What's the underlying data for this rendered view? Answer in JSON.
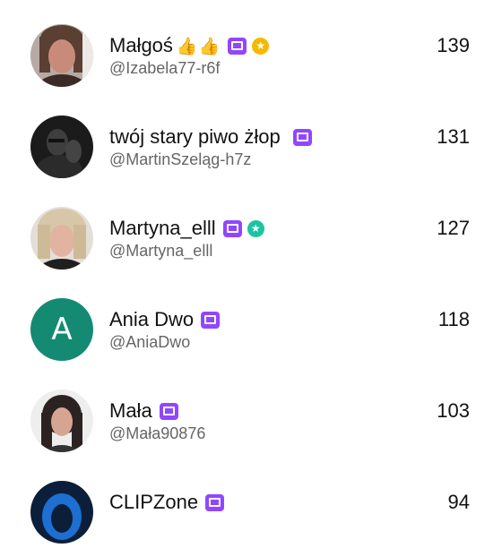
{
  "colors": {
    "sub_badge": "#9146ff",
    "gold_badge": "#f5b800",
    "teal_badge": "#1cc4a0",
    "letter_avatar": "#148a72"
  },
  "rows": [
    {
      "name": "Małgoś",
      "emoji": "👍👍",
      "handle": "@Izabela77-r6f",
      "score": "139",
      "badge_icon": "sub-badge-icon",
      "extra_badge": "gold-star-badge-icon"
    },
    {
      "name": "twój stary piwo żłop",
      "handle": "@MartinSzeląg-h7z",
      "score": "131",
      "badge_icon": "sub-badge-icon"
    },
    {
      "name": "Martyna_elll",
      "handle": "@Martyna_elll",
      "score": "127",
      "badge_icon": "sub-badge-icon",
      "extra_badge": "teal-star-badge-icon"
    },
    {
      "name": "Ania Dwo",
      "handle": "@AniaDwo",
      "score": "118",
      "badge_icon": "sub-badge-icon",
      "avatar_letter": "A"
    },
    {
      "name": "Mała",
      "handle": "@Mała90876",
      "score": "103",
      "badge_icon": "sub-badge-icon"
    },
    {
      "name": "CLIPZone",
      "score": "94",
      "badge_icon": "sub-badge-icon"
    }
  ]
}
